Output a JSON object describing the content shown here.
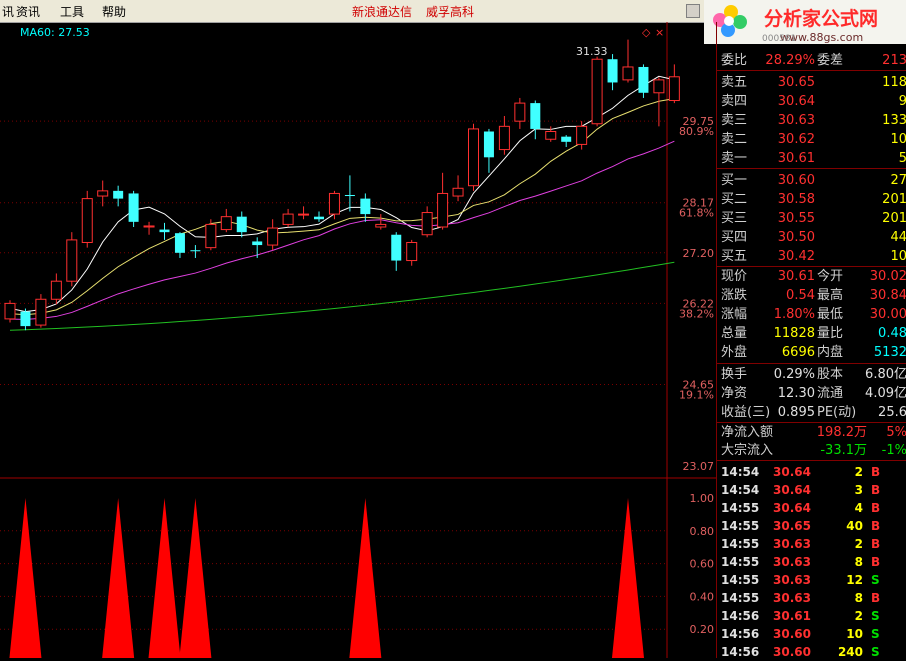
{
  "menu": {
    "item0": "资讯",
    "item1": "工具",
    "item2": "帮助",
    "link0": "新浪通达信",
    "link1": "威孚高科"
  },
  "logo": {
    "brand": "分析家公式网",
    "url": "www.88gs.com",
    "code": "000581"
  },
  "chart": {
    "ma_label": "MA60: 27.53",
    "price_axis": [
      "29.75",
      "80.9%",
      "28.17",
      "61.8%",
      "27.20",
      "26.22",
      "38.2%",
      "24.65",
      "19.1%",
      "23.07"
    ],
    "peak_label": "31.33",
    "sub_axis": [
      "1.00",
      "0.80",
      "0.60",
      "0.40",
      "0.20"
    ]
  },
  "chart_data": {
    "type": "candlestick",
    "price_ylim": [
      23.07,
      31.4
    ],
    "candles": [
      {
        "o": 25.92,
        "c": 26.22,
        "h": 26.28,
        "l": 25.85
      },
      {
        "o": 26.06,
        "c": 25.78,
        "h": 26.12,
        "l": 25.7
      },
      {
        "o": 25.8,
        "c": 26.3,
        "h": 26.4,
        "l": 25.75
      },
      {
        "o": 26.3,
        "c": 26.65,
        "h": 26.8,
        "l": 26.2
      },
      {
        "o": 26.65,
        "c": 27.45,
        "h": 27.6,
        "l": 26.55
      },
      {
        "o": 27.4,
        "c": 28.25,
        "h": 28.4,
        "l": 27.3
      },
      {
        "o": 28.3,
        "c": 28.4,
        "h": 28.6,
        "l": 28.1
      },
      {
        "o": 28.4,
        "c": 28.25,
        "h": 28.5,
        "l": 28.1
      },
      {
        "o": 28.35,
        "c": 27.8,
        "h": 28.4,
        "l": 27.7
      },
      {
        "o": 27.7,
        "c": 27.72,
        "h": 27.8,
        "l": 27.55
      },
      {
        "o": 27.65,
        "c": 27.6,
        "h": 27.78,
        "l": 27.45
      },
      {
        "o": 27.58,
        "c": 27.2,
        "h": 27.6,
        "l": 27.1
      },
      {
        "o": 27.25,
        "c": 27.23,
        "h": 27.35,
        "l": 27.1
      },
      {
        "o": 27.3,
        "c": 27.75,
        "h": 27.85,
        "l": 27.25
      },
      {
        "o": 27.65,
        "c": 27.9,
        "h": 28.05,
        "l": 27.6
      },
      {
        "o": 27.9,
        "c": 27.6,
        "h": 28.0,
        "l": 27.5
      },
      {
        "o": 27.42,
        "c": 27.35,
        "h": 27.5,
        "l": 27.1
      },
      {
        "o": 27.35,
        "c": 27.68,
        "h": 27.85,
        "l": 27.25
      },
      {
        "o": 27.75,
        "c": 27.95,
        "h": 28.05,
        "l": 27.7
      },
      {
        "o": 27.95,
        "c": 27.95,
        "h": 28.1,
        "l": 27.85
      },
      {
        "o": 27.9,
        "c": 27.85,
        "h": 28.0,
        "l": 27.8
      },
      {
        "o": 27.95,
        "c": 28.35,
        "h": 28.4,
        "l": 27.85
      },
      {
        "o": 28.32,
        "c": 28.3,
        "h": 28.7,
        "l": 28.0
      },
      {
        "o": 28.25,
        "c": 27.95,
        "h": 28.35,
        "l": 27.8
      },
      {
        "o": 27.7,
        "c": 27.75,
        "h": 27.95,
        "l": 27.65
      },
      {
        "o": 27.55,
        "c": 27.05,
        "h": 27.6,
        "l": 26.85
      },
      {
        "o": 27.05,
        "c": 27.4,
        "h": 27.45,
        "l": 26.95
      },
      {
        "o": 27.55,
        "c": 27.98,
        "h": 28.1,
        "l": 27.5
      },
      {
        "o": 27.7,
        "c": 28.35,
        "h": 28.75,
        "l": 27.65
      },
      {
        "o": 28.3,
        "c": 28.45,
        "h": 28.7,
        "l": 28.2
      },
      {
        "o": 28.5,
        "c": 29.6,
        "h": 29.7,
        "l": 28.4
      },
      {
        "o": 29.55,
        "c": 29.05,
        "h": 29.6,
        "l": 28.75
      },
      {
        "o": 29.2,
        "c": 29.65,
        "h": 29.85,
        "l": 29.1
      },
      {
        "o": 29.75,
        "c": 30.1,
        "h": 30.2,
        "l": 29.6
      },
      {
        "o": 30.1,
        "c": 29.6,
        "h": 30.15,
        "l": 29.4
      },
      {
        "o": 29.4,
        "c": 29.55,
        "h": 29.65,
        "l": 29.35
      },
      {
        "o": 29.45,
        "c": 29.35,
        "h": 29.48,
        "l": 29.25
      },
      {
        "o": 29.3,
        "c": 29.65,
        "h": 29.75,
        "l": 29.2
      },
      {
        "o": 29.7,
        "c": 30.95,
        "h": 31.0,
        "l": 29.65
      },
      {
        "o": 30.95,
        "c": 30.5,
        "h": 31.05,
        "l": 30.35
      },
      {
        "o": 30.55,
        "c": 30.8,
        "h": 31.33,
        "l": 30.5
      },
      {
        "o": 30.8,
        "c": 30.3,
        "h": 30.85,
        "l": 30.2
      },
      {
        "o": 30.3,
        "c": 30.55,
        "h": 30.6,
        "l": 29.65
      },
      {
        "o": 30.15,
        "c": 30.61,
        "h": 30.85,
        "l": 30.1
      }
    ],
    "signal_peaks_index": [
      1,
      7,
      10,
      12,
      23,
      40
    ]
  },
  "panel": {
    "weibi": {
      "label": "委比",
      "value": "28.29%",
      "label2": "委差",
      "value2": "213"
    },
    "sell": [
      {
        "label": "卖五",
        "price": "30.65",
        "vol": "118"
      },
      {
        "label": "卖四",
        "price": "30.64",
        "vol": "9"
      },
      {
        "label": "卖三",
        "price": "30.63",
        "vol": "133"
      },
      {
        "label": "卖二",
        "price": "30.62",
        "vol": "10"
      },
      {
        "label": "卖一",
        "price": "30.61",
        "vol": "5"
      }
    ],
    "buy": [
      {
        "label": "买一",
        "price": "30.60",
        "vol": "27"
      },
      {
        "label": "买二",
        "price": "30.58",
        "vol": "201"
      },
      {
        "label": "买三",
        "price": "30.55",
        "vol": "201"
      },
      {
        "label": "买四",
        "price": "30.50",
        "vol": "44"
      },
      {
        "label": "买五",
        "price": "30.42",
        "vol": "10"
      }
    ],
    "quote1": [
      {
        "l1": "现价",
        "v1": "30.61",
        "l2": "今开",
        "v2": "30.02"
      },
      {
        "l1": "涨跌",
        "v1": "0.54",
        "l2": "最高",
        "v2": "30.84"
      },
      {
        "l1": "涨幅",
        "v1": "1.80%",
        "l2": "最低",
        "v2": "30.00"
      },
      {
        "l1": "总量",
        "v1": "11828",
        "l2": "量比",
        "v2": "0.48"
      },
      {
        "l1": "外盘",
        "v1": "6696",
        "l2": "内盘",
        "v2": "5132"
      }
    ],
    "quote2": [
      {
        "l1": "换手",
        "v1": "0.29%",
        "l2": "股本",
        "v2": "6.80亿"
      },
      {
        "l1": "净资",
        "v1": "12.30",
        "l2": "流通",
        "v2": "4.09亿"
      },
      {
        "l1": "收益(三)",
        "v1": "0.895",
        "l2": "PE(动)",
        "v2": "25.6"
      }
    ],
    "flow": [
      {
        "label": "净流入额",
        "value": "198.2万",
        "pct": "5%"
      },
      {
        "label": "大宗流入",
        "value": "-33.1万",
        "pct": "-1%"
      }
    ],
    "ticks": [
      {
        "t": "14:54",
        "p": "30.64",
        "v": "2",
        "d": "B"
      },
      {
        "t": "14:54",
        "p": "30.64",
        "v": "3",
        "d": "B"
      },
      {
        "t": "14:55",
        "p": "30.64",
        "v": "4",
        "d": "B"
      },
      {
        "t": "14:55",
        "p": "30.65",
        "v": "40",
        "d": "B"
      },
      {
        "t": "14:55",
        "p": "30.63",
        "v": "2",
        "d": "B"
      },
      {
        "t": "14:55",
        "p": "30.63",
        "v": "8",
        "d": "B"
      },
      {
        "t": "14:55",
        "p": "30.63",
        "v": "12",
        "d": "S"
      },
      {
        "t": "14:55",
        "p": "30.63",
        "v": "8",
        "d": "B"
      },
      {
        "t": "14:56",
        "p": "30.61",
        "v": "2",
        "d": "S"
      },
      {
        "t": "14:56",
        "p": "30.60",
        "v": "10",
        "d": "S"
      },
      {
        "t": "14:56",
        "p": "30.60",
        "v": "240",
        "d": "S"
      }
    ]
  }
}
